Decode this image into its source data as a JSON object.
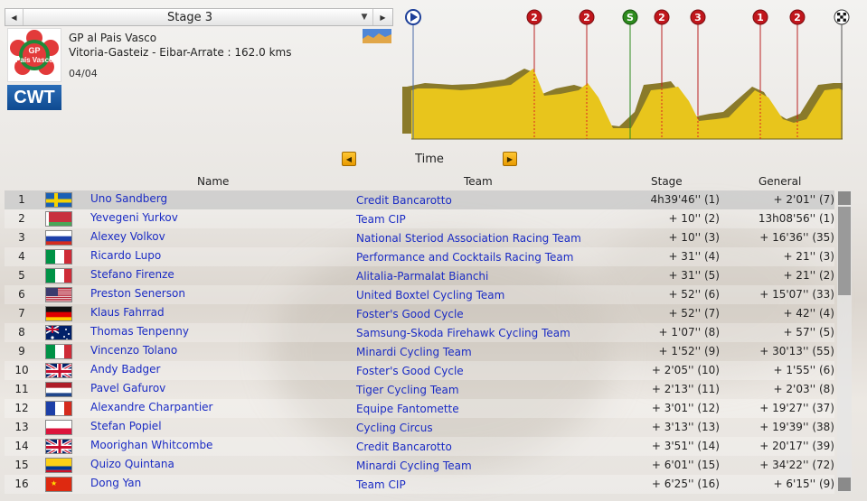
{
  "stage_selector": {
    "label": "Stage 3",
    "prev_icon": "triangle-left-icon",
    "next_icon": "triangle-right-icon",
    "dropdown_icon": "triangle-down-icon"
  },
  "race": {
    "logo_text_top": "GP",
    "logo_text_bottom": "País Vasco",
    "badge": "CWT",
    "name": "GP al Pais Vasco",
    "route": "Vitoria-Gasteiz - Eibar-Arrate : 162.0 kms",
    "date": "04/04"
  },
  "profile": {
    "markers": [
      {
        "type": "start",
        "label": ""
      },
      {
        "type": "climb",
        "label": "2",
        "color": "#c0161c"
      },
      {
        "type": "climb",
        "label": "2",
        "color": "#c0161c"
      },
      {
        "type": "sprint",
        "label": "S",
        "color": "#2e8b1e"
      },
      {
        "type": "climb",
        "label": "2",
        "color": "#c0161c"
      },
      {
        "type": "climb",
        "label": "3",
        "color": "#c0161c"
      },
      {
        "type": "climb",
        "label": "1",
        "color": "#c0161c"
      },
      {
        "type": "climb",
        "label": "2",
        "color": "#c0161c"
      },
      {
        "type": "finish",
        "label": ""
      }
    ]
  },
  "time_selector": {
    "label": "Time",
    "prev_icon": "triangle-left-icon",
    "next_icon": "triangle-right-icon"
  },
  "columns": {
    "name": "Name",
    "team": "Team",
    "stage": "Stage",
    "general": "General"
  },
  "rows": [
    {
      "rank": "1",
      "flag": "SE",
      "name": "Uno Sandberg",
      "team": "Credit Bancarotto",
      "stage": "4h39'46'' (1)",
      "general": "+ 2'01'' (7)"
    },
    {
      "rank": "2",
      "flag": "BY",
      "name": "Yevegeni Yurkov",
      "team": "Team CIP",
      "stage": "+ 10'' (2)",
      "general": "13h08'56'' (1)"
    },
    {
      "rank": "3",
      "flag": "RU",
      "name": "Alexey Volkov",
      "team": "National Steriod Association Racing Team",
      "stage": "+ 10'' (3)",
      "general": "+ 16'36'' (35)"
    },
    {
      "rank": "4",
      "flag": "IT",
      "name": "Ricardo Lupo",
      "team": "Performance and Cocktails Racing Team",
      "stage": "+ 31'' (4)",
      "general": "+ 21'' (3)"
    },
    {
      "rank": "5",
      "flag": "IT",
      "name": "Stefano Firenze",
      "team": "Alitalia-Parmalat Bianchi",
      "stage": "+ 31'' (5)",
      "general": "+ 21'' (2)"
    },
    {
      "rank": "6",
      "flag": "US",
      "name": "Preston Senerson",
      "team": "United Boxtel Cycling Team",
      "stage": "+ 52'' (6)",
      "general": "+ 15'07'' (33)"
    },
    {
      "rank": "7",
      "flag": "DE",
      "name": "Klaus Fahrrad",
      "team": "Foster's Good Cycle",
      "stage": "+ 52'' (7)",
      "general": "+ 42'' (4)"
    },
    {
      "rank": "8",
      "flag": "AU",
      "name": "Thomas Tenpenny",
      "team": "Samsung-Skoda Firehawk Cycling Team",
      "stage": "+ 1'07'' (8)",
      "general": "+ 57'' (5)"
    },
    {
      "rank": "9",
      "flag": "IT",
      "name": "Vincenzo Tolano",
      "team": "Minardi Cycling Team",
      "stage": "+ 1'52'' (9)",
      "general": "+ 30'13'' (55)"
    },
    {
      "rank": "10",
      "flag": "GB",
      "name": "Andy Badger",
      "team": "Foster's Good Cycle",
      "stage": "+ 2'05'' (10)",
      "general": "+ 1'55'' (6)"
    },
    {
      "rank": "11",
      "flag": "NL",
      "name": "Pavel Gafurov",
      "team": "Tiger Cycling Team",
      "stage": "+ 2'13'' (11)",
      "general": "+ 2'03'' (8)"
    },
    {
      "rank": "12",
      "flag": "FR",
      "name": "Alexandre Charpantier",
      "team": "Equipe Fantomette",
      "stage": "+ 3'01'' (12)",
      "general": "+ 19'27'' (37)"
    },
    {
      "rank": "13",
      "flag": "PL",
      "name": "Stefan Popiel",
      "team": "Cycling Circus",
      "stage": "+ 3'13'' (13)",
      "general": "+ 19'39'' (38)"
    },
    {
      "rank": "14",
      "flag": "GB",
      "name": "Moorighan Whitcombe",
      "team": "Credit Bancarotto",
      "stage": "+ 3'51'' (14)",
      "general": "+ 20'17'' (39)"
    },
    {
      "rank": "15",
      "flag": "CO",
      "name": "Quizo Quintana",
      "team": "Minardi Cycling Team",
      "stage": "+ 6'01'' (15)",
      "general": "+ 34'22'' (72)"
    },
    {
      "rank": "16",
      "flag": "CN",
      "name": "Dong Yan",
      "team": "Team CIP",
      "stage": "+ 6'25'' (16)",
      "general": "+ 6'15'' (9)"
    }
  ]
}
